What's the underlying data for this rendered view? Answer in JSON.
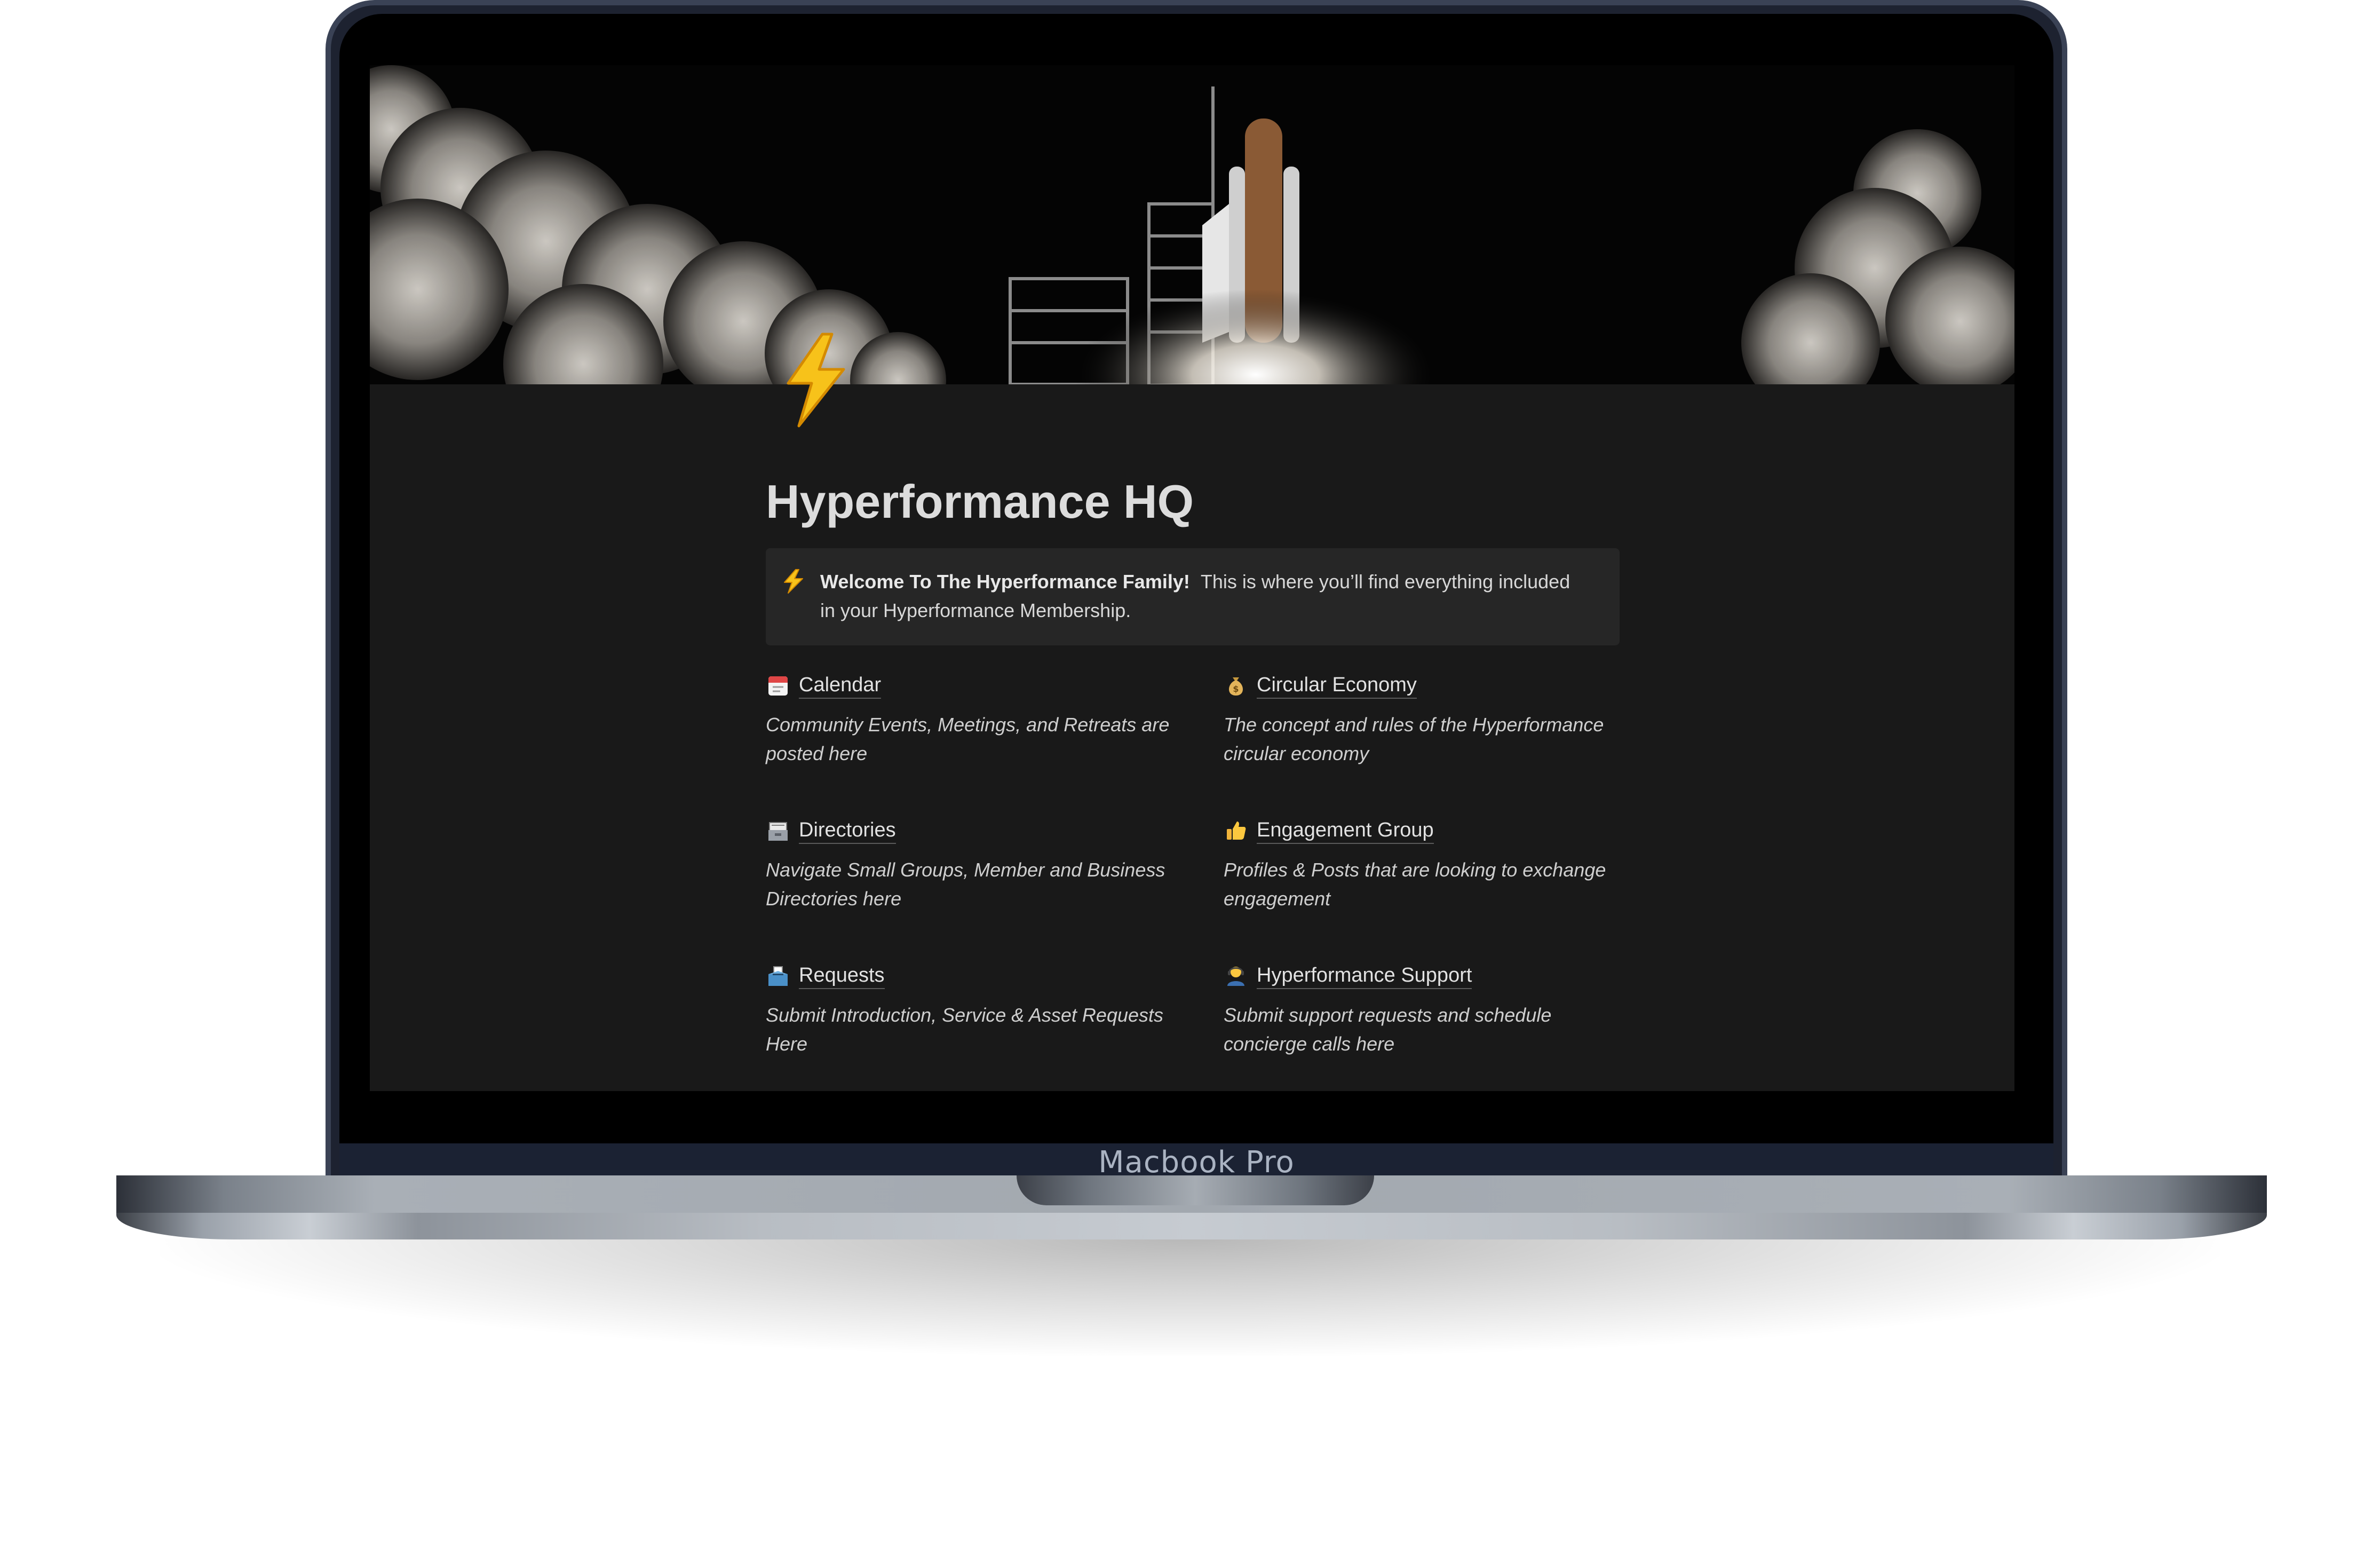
{
  "device": {
    "model_label": "Macbook Pro"
  },
  "page": {
    "title": "Hyperformance HQ",
    "icon": "lightning-icon",
    "cover": "rocket-launch-cover-image"
  },
  "callout": {
    "icon": "lightning-icon",
    "bold": "Welcome To The Hyperformance Family!",
    "text": "This is where you’ll find everything included in your Hyperformance Membership."
  },
  "cards": [
    {
      "icon": "calendar-icon",
      "title": "Calendar",
      "description": "Community Events, Meetings, and Retreats are posted here"
    },
    {
      "icon": "money-bag-icon",
      "title": "Circular Economy",
      "description": "The concept and rules of the Hyperformance circular economy"
    },
    {
      "icon": "card-file-box-icon",
      "title": "Directories",
      "description": "Navigate Small Groups, Member and Business Directories here"
    },
    {
      "icon": "thumbs-up-icon",
      "title": "Engagement Group",
      "description": "Profiles & Posts that are looking to exchange engagement"
    },
    {
      "icon": "ballot-box-icon",
      "title": "Requests",
      "description": "Submit Introduction, Service & Asset Requests Here"
    },
    {
      "icon": "support-agent-icon",
      "title": "Hyperformance Support",
      "description": "Submit support requests and schedule concierge calls here"
    }
  ]
}
